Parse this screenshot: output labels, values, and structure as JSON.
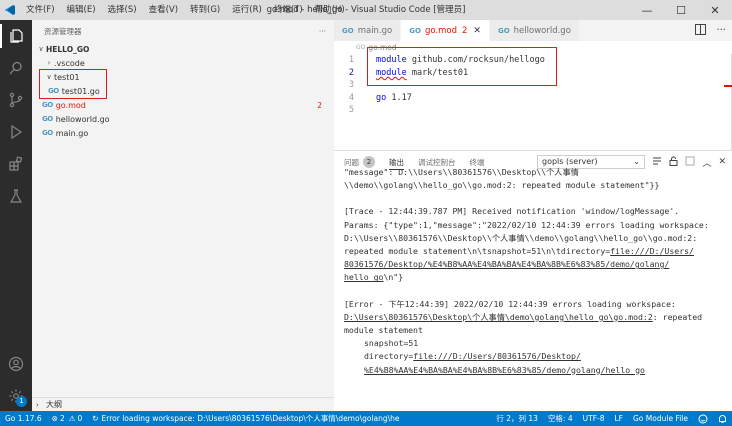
{
  "titlebar": {
    "menu": [
      "文件(F)",
      "编辑(E)",
      "选择(S)",
      "查看(V)",
      "转到(G)",
      "运行(R)",
      "终端(T)",
      "帮助(H)"
    ],
    "title": "go.mod - hello_go - Visual Studio Code [管理员]",
    "controls": {
      "minimize": "—",
      "maximize": "☐",
      "close": "✕"
    }
  },
  "activitybar": {
    "icons": [
      "files-icon",
      "search-icon",
      "source-control-icon",
      "run-debug-icon",
      "extensions-icon",
      "testing-icon",
      "account-icon",
      "manage-gear-icon"
    ],
    "manage_badge": "1"
  },
  "sidebar": {
    "title": "资源管理器",
    "more": "···",
    "root": "HELLO_GO",
    "items": [
      {
        "label": ".vscode",
        "type": "folder",
        "expanded": false
      },
      {
        "label": "test01",
        "type": "folder",
        "expanded": true
      },
      {
        "label": "test01.go",
        "type": "go"
      },
      {
        "label": "go.mod",
        "type": "go",
        "error_count": "2"
      },
      {
        "label": "helloworld.go",
        "type": "go"
      },
      {
        "label": "main.go",
        "type": "go"
      }
    ],
    "outline": "大纲"
  },
  "editor": {
    "tabs": [
      {
        "label": "main.go",
        "active": false
      },
      {
        "label": "go.mod",
        "active": true,
        "count": "2",
        "close": "✕"
      },
      {
        "label": "helloworld.go",
        "active": false
      }
    ],
    "breadcrumb": "go.mod",
    "lines": [
      {
        "n": "1",
        "kw": "module",
        "rest": " github.com/rocksun/hellogo"
      },
      {
        "n": "2",
        "kw": "module",
        "rest": " mark/test01"
      },
      {
        "n": "3",
        "kw": "",
        "rest": ""
      },
      {
        "n": "4",
        "kw": "go",
        "rest": " 1.17"
      },
      {
        "n": "5",
        "kw": "",
        "rest": ""
      }
    ]
  },
  "panel": {
    "tabs": {
      "problems": "问题",
      "problems_count": "2",
      "output": "输出",
      "debug_console": "调试控制台",
      "terminal": "终端"
    },
    "output_select": "gopls (server)",
    "log": {
      "l0": "\"message\": D:\\\\Users\\\\80361576\\\\Desktop\\\\个人事情",
      "l1": "\\\\demo\\\\golang\\\\hello_go\\\\go.mod:2: repeated module statement\"}}",
      "l2": "[Trace - 12:44:39.787 PM] Received notification 'window/logMessage'.",
      "l3": "Params: {\"type\":1,\"message\":\"2022/02/10 12:44:39 errors loading workspace:",
      "l4": "D:\\\\Users\\\\80361576\\\\Desktop\\\\个人事情\\\\demo\\\\golang\\\\hello_go\\\\go.mod:2:",
      "l5a": "repeated module statement\\n\\tsnapshot=51\\n\\tdirectory=",
      "l5b": "file:///D:/Users/",
      "l6": "80361576/Desktop/%E4%B8%AA%E4%BA%BA%E4%BA%8B%E6%83%85/demo/golang/",
      "l7a": "hello_go",
      "l7b": "\\n\"}",
      "l8": "[Error - 下午12:44:39] 2022/02/10 12:44:39 errors loading workspace:",
      "l9a": "D:\\Users\\80361576\\Desktop\\个人事情\\demo\\golang\\hello_go\\go.mod:2",
      "l9b": ": repeated",
      "l10": "module statement",
      "l11": "snapshot=51",
      "l12a": "directory=",
      "l12b": "file:///D:/Users/80361576/Desktop/",
      "l13": "%E4%B8%AA%E4%BA%BA%E4%BA%8B%E6%83%85/demo/golang/hello_go"
    }
  },
  "statusbar": {
    "go_version": "Go 1.17.6",
    "errors": "2",
    "warnings": "0",
    "message": "Error loading workspace: D:\\Users\\80361576\\Desktop\\个人事情\\demo\\golang\\he",
    "position": "行 2，列 13",
    "spaces": "空格: 4",
    "encoding": "UTF-8",
    "eol": "LF",
    "language": "Go Module File",
    "colors": {
      "background": "#007acc",
      "foreground": "#ffffff"
    }
  }
}
